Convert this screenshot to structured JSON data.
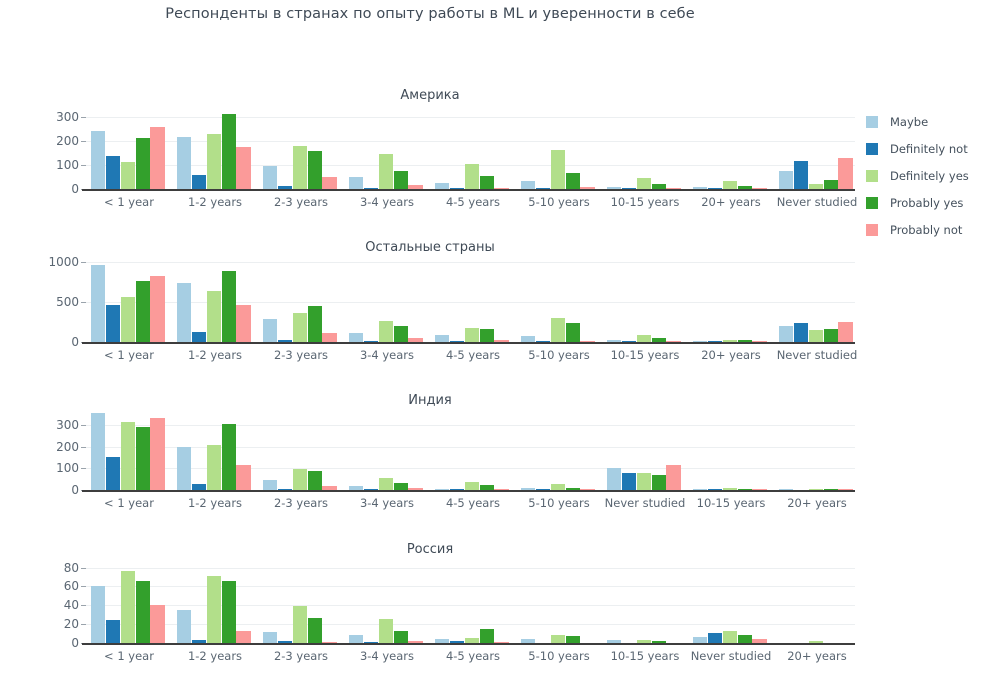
{
  "chart_data": {
    "type": "bar",
    "title": "Респонденты в странах по опыту работы в ML и уверенности в себе",
    "xlabel": "",
    "ylabel": "",
    "grid": true,
    "legend_position": "right",
    "legend": [
      "Maybe",
      "Definitely not",
      "Definitely yes",
      "Probably yes",
      "Probably not"
    ],
    "colors": [
      "#a6cee3",
      "#1f78b4",
      "#b2df8a",
      "#33a02c",
      "#fb9a99"
    ],
    "subplots": [
      {
        "title": "Америка",
        "ylim": [
          0,
          330
        ],
        "yticks": [
          0,
          100,
          200,
          300
        ],
        "categories": [
          "< 1 year",
          "1-2 years",
          "2-3 years",
          "3-4 years",
          "4-5 years",
          "5-10 years",
          "10-15 years",
          "20+ years",
          "Never studied"
        ],
        "series": [
          {
            "name": "Maybe",
            "values": [
              241,
              217,
              95,
              51,
              24,
              33,
              7,
              9,
              77
            ]
          },
          {
            "name": "Definitely not",
            "values": [
              139,
              60,
              11,
              4,
              3,
              6,
              1,
              1,
              118
            ]
          },
          {
            "name": "Definitely yes",
            "values": [
              113,
              229,
              180,
              148,
              104,
              161,
              48,
              35,
              20
            ]
          },
          {
            "name": "Probably yes",
            "values": [
              212,
              315,
              158,
              75,
              53,
              67,
              23,
              12,
              37
            ]
          },
          {
            "name": "Probably not",
            "values": [
              259,
              177,
              52,
              18,
              6,
              9,
              3,
              3,
              128
            ]
          }
        ]
      },
      {
        "title": "Остальные страны",
        "ylim": [
          0,
          1050
        ],
        "yticks": [
          0,
          500,
          1000
        ],
        "categories": [
          "< 1 year",
          "1-2 years",
          "2-3 years",
          "3-4 years",
          "4-5 years",
          "5-10 years",
          "10-15 years",
          "20+ years",
          "Never studied"
        ],
        "series": [
          {
            "name": "Maybe",
            "values": [
              965,
              735,
              285,
              112,
              92,
              75,
              25,
              8,
              198
            ]
          },
          {
            "name": "Definitely not",
            "values": [
              468,
              120,
              22,
              12,
              10,
              12,
              4,
              2,
              232
            ]
          },
          {
            "name": "Definitely yes",
            "values": [
              560,
              640,
              365,
              265,
              175,
              300,
              85,
              30,
              152
            ]
          },
          {
            "name": "Probably yes",
            "values": [
              765,
              885,
              450,
              205,
              160,
              240,
              45,
              22,
              168
            ]
          },
          {
            "name": "Probably not",
            "values": [
              825,
              460,
              110,
              52,
              22,
              18,
              8,
              4,
              252
            ]
          }
        ]
      },
      {
        "title": "Индия",
        "ylim": [
          0,
          370
        ],
        "yticks": [
          0,
          100,
          200,
          300
        ],
        "categories": [
          "< 1 year",
          "1-2 years",
          "2-3 years",
          "3-4 years",
          "4-5 years",
          "5-10 years",
          "Never studied",
          "10-15 years",
          "20+ years"
        ],
        "series": [
          {
            "name": "Maybe",
            "values": [
              355,
              198,
              46,
              19,
              6,
              9,
              100,
              2,
              1
            ]
          },
          {
            "name": "Definitely not",
            "values": [
              152,
              27,
              3,
              2,
              1,
              1,
              80,
              1,
              0
            ]
          },
          {
            "name": "Definitely yes",
            "values": [
              313,
              210,
              97,
              54,
              38,
              30,
              80,
              9,
              5
            ]
          },
          {
            "name": "Probably yes",
            "values": [
              291,
              307,
              88,
              32,
              25,
              10,
              70,
              6,
              2
            ]
          },
          {
            "name": "Probably not",
            "values": [
              333,
              118,
              20,
              8,
              3,
              2,
              115,
              1,
              1
            ]
          }
        ]
      },
      {
        "title": "Россия",
        "ylim": [
          0,
          88
        ],
        "yticks": [
          0,
          20,
          40,
          60,
          80
        ],
        "categories": [
          "< 1 year",
          "1-2 years",
          "2-3 years",
          "3-4 years",
          "4-5 years",
          "5-10 years",
          "10-15 years",
          "Never studied",
          "20+ years"
        ],
        "series": [
          {
            "name": "Maybe",
            "values": [
              60,
              35,
              12,
              9,
              4,
              4,
              3,
              6,
              0
            ]
          },
          {
            "name": "Definitely not",
            "values": [
              24,
              3,
              2,
              1,
              2,
              0,
              0,
              11,
              0
            ]
          },
          {
            "name": "Definitely yes",
            "values": [
              76,
              71,
              39,
              25,
              5,
              9,
              3,
              13,
              2
            ]
          },
          {
            "name": "Probably yes",
            "values": [
              66,
              66,
              27,
              13,
              15,
              7,
              2,
              9,
              0
            ]
          },
          {
            "name": "Probably not",
            "values": [
              40,
              13,
              1,
              2,
              1,
              0,
              0,
              4,
              0
            ]
          }
        ]
      }
    ]
  }
}
